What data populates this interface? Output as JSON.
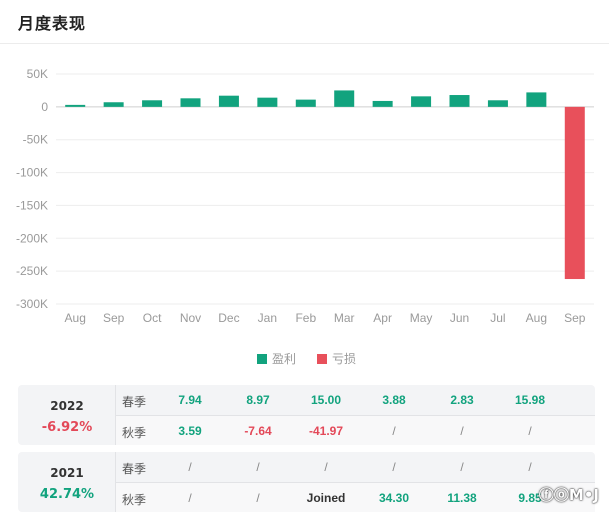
{
  "header": {
    "title": "月度表现"
  },
  "colors": {
    "profit": "#12a37e",
    "loss": "#e8505b",
    "grid": "#ededed"
  },
  "chart_data": {
    "type": "bar",
    "categories": [
      "Aug",
      "Sep",
      "Oct",
      "Nov",
      "Dec",
      "Jan",
      "Feb",
      "Mar",
      "Apr",
      "May",
      "Jun",
      "Jul",
      "Aug",
      "Sep"
    ],
    "values": [
      3000,
      7000,
      10000,
      13000,
      17000,
      14000,
      11000,
      25000,
      9000,
      16000,
      18000,
      10000,
      22000,
      -262000
    ],
    "yticks": [
      50000,
      0,
      -50000,
      -100000,
      -150000,
      -200000,
      -250000,
      -300000
    ],
    "ytick_labels": [
      "50K",
      "0",
      "-50K",
      "-100K",
      "-150K",
      "-200K",
      "-250K",
      "-300K"
    ],
    "ylim": [
      -300000,
      50000
    ],
    "grid": true,
    "legend": [
      "盈利",
      "亏损"
    ],
    "legend_position": "bottom-center"
  },
  "table": {
    "years": [
      {
        "year": "2022",
        "return": "-6.92%",
        "return_sign": "neg",
        "rows": [
          {
            "label": "春季",
            "values": [
              "7.94",
              "8.97",
              "15.00",
              "3.88",
              "2.83",
              "15.98"
            ]
          },
          {
            "label": "秋季",
            "values": [
              "3.59",
              "-7.64",
              "-41.97",
              "/",
              "/",
              "/"
            ]
          }
        ]
      },
      {
        "year": "2021",
        "return": "42.74%",
        "return_sign": "pos",
        "rows": [
          {
            "label": "春季",
            "values": [
              "/",
              "/",
              "/",
              "/",
              "/",
              "/"
            ]
          },
          {
            "label": "秋季",
            "values": [
              "/",
              "/",
              "Joined",
              "34.30",
              "11.38",
              "9.85"
            ]
          }
        ]
      }
    ]
  },
  "watermark": "ⓕⓞM•J"
}
